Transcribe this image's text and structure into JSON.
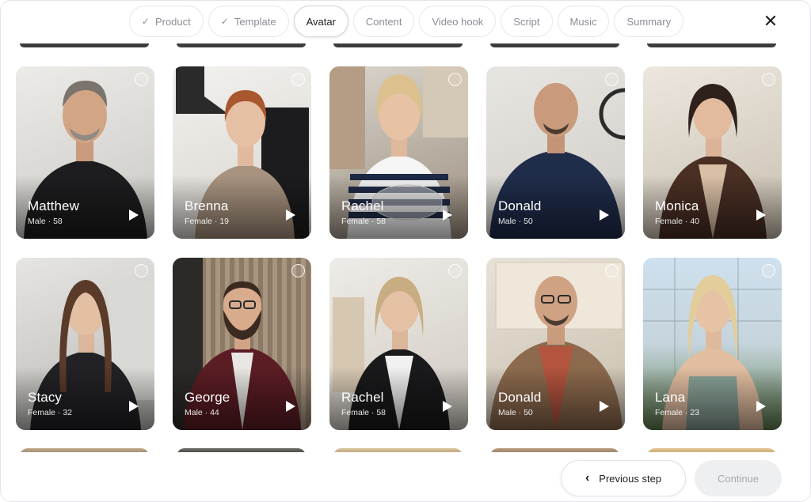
{
  "stepper": {
    "steps": [
      {
        "label": "Product",
        "state": "done"
      },
      {
        "label": "Template",
        "state": "done"
      },
      {
        "label": "Avatar",
        "state": "active"
      },
      {
        "label": "Content",
        "state": "todo"
      },
      {
        "label": "Video hook",
        "state": "todo"
      },
      {
        "label": "Script",
        "state": "todo"
      },
      {
        "label": "Music",
        "state": "todo"
      },
      {
        "label": "Summary",
        "state": "todo"
      }
    ],
    "close_icon": "close-icon"
  },
  "avatars": [
    {
      "name": "Matthew",
      "meta": "Male · 58"
    },
    {
      "name": "Brenna",
      "meta": "Female · 19"
    },
    {
      "name": "Rachel",
      "meta": "Female · 58"
    },
    {
      "name": "Donald",
      "meta": "Male · 50"
    },
    {
      "name": "Monica",
      "meta": "Female · 40"
    },
    {
      "name": "Stacy",
      "meta": "Female · 32"
    },
    {
      "name": "George",
      "meta": "Male · 44"
    },
    {
      "name": "Rachel",
      "meta": "Female · 58"
    },
    {
      "name": "Donald",
      "meta": "Male · 50"
    },
    {
      "name": "Lana",
      "meta": "Female · 23"
    }
  ],
  "footer": {
    "prev_label": "Previous step",
    "continue_label": "Continue"
  }
}
